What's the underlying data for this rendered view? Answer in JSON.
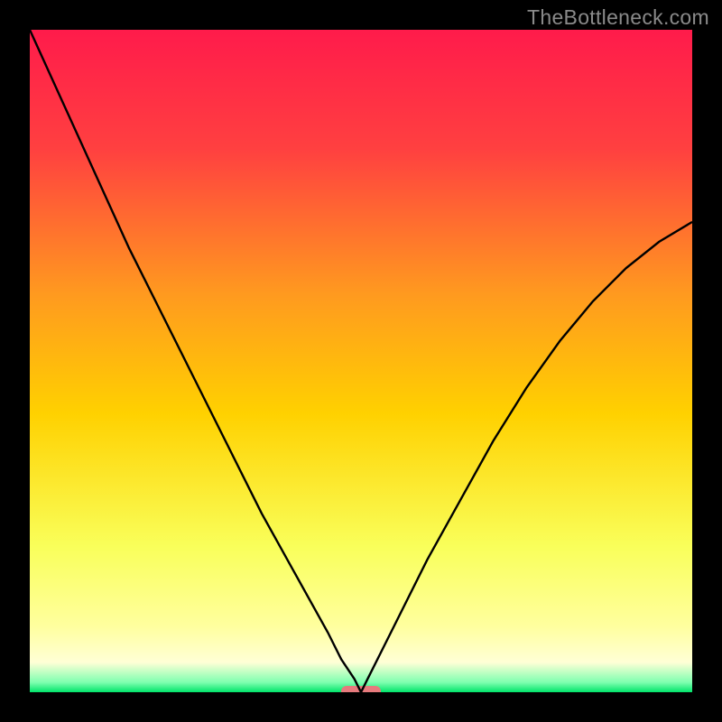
{
  "watermark": "TheBottleneck.com",
  "chart_data": {
    "type": "line",
    "title": "",
    "xlabel": "",
    "ylabel": "",
    "xlim": [
      0,
      100
    ],
    "ylim": [
      0,
      100
    ],
    "x": [
      0,
      5,
      10,
      15,
      20,
      25,
      30,
      35,
      40,
      45,
      47,
      49,
      50,
      51,
      53,
      55,
      60,
      65,
      70,
      75,
      80,
      85,
      90,
      95,
      100
    ],
    "values": [
      100,
      89,
      78,
      67,
      57,
      47,
      37,
      27,
      18,
      9,
      5,
      2,
      0,
      2,
      6,
      10,
      20,
      29,
      38,
      46,
      53,
      59,
      64,
      68,
      71
    ],
    "marker": {
      "x_range": [
        47,
        53
      ],
      "y": 0,
      "color": "#e77a7d"
    },
    "gradient_stops": [
      {
        "pos": 0.0,
        "color": "#ff1b4b"
      },
      {
        "pos": 0.18,
        "color": "#ff4040"
      },
      {
        "pos": 0.4,
        "color": "#ff9a1f"
      },
      {
        "pos": 0.58,
        "color": "#ffd100"
      },
      {
        "pos": 0.78,
        "color": "#f9ff5a"
      },
      {
        "pos": 0.9,
        "color": "#ffff9e"
      },
      {
        "pos": 0.955,
        "color": "#ffffd6"
      },
      {
        "pos": 0.985,
        "color": "#7fffb0"
      },
      {
        "pos": 1.0,
        "color": "#00e46a"
      }
    ],
    "line_color": "#000000",
    "bg_frame_color": "#000000"
  }
}
